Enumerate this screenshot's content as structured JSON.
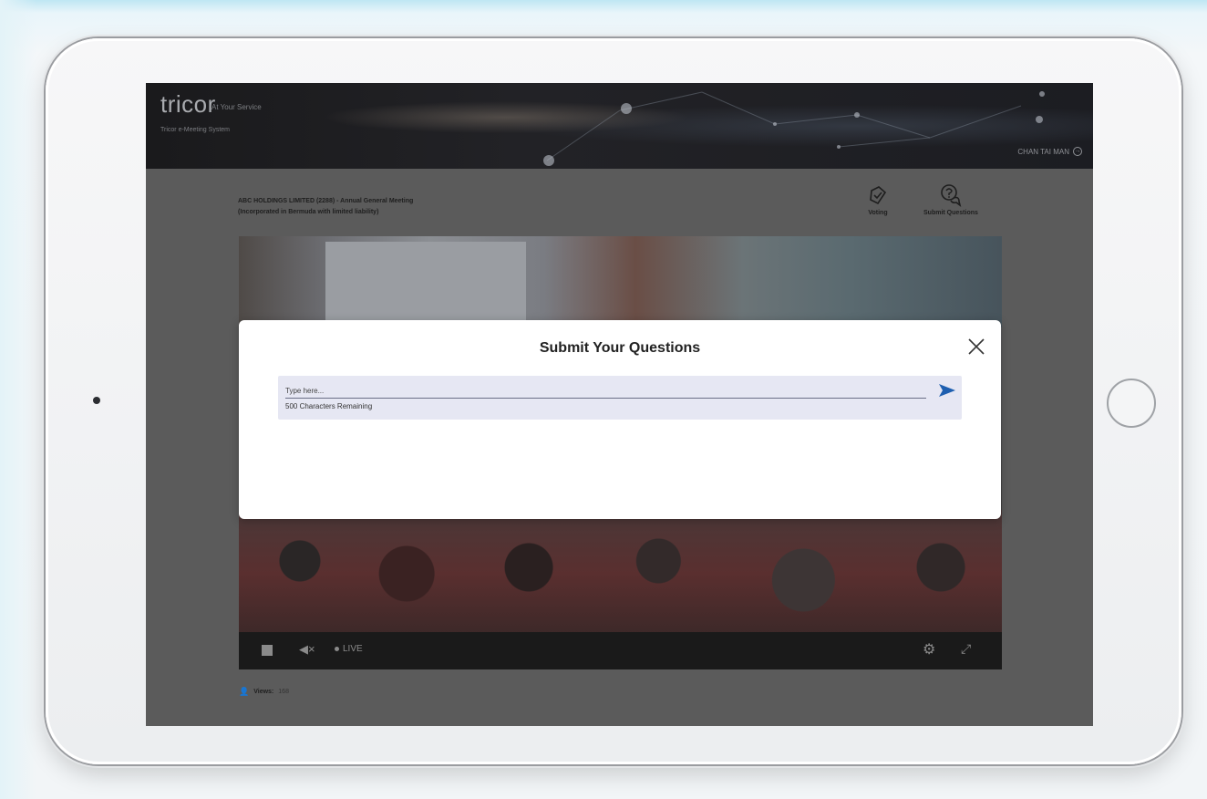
{
  "header": {
    "logo_text": "tricor",
    "tagline": "At Your Service",
    "system_name": "Tricor e-Meeting System",
    "user_name": "CHAN TAI MAN"
  },
  "meeting": {
    "title_line1": "ABC HOLDINGS LIMITED (2288) - Annual General Meeting",
    "title_line2": "(Incorporated in Bermuda with limited liability)"
  },
  "actions": {
    "voting_label": "Voting",
    "submit_questions_label": "Submit Questions"
  },
  "player": {
    "live_label": "LIVE"
  },
  "stats": {
    "views_label": "Views:",
    "views_count": "168"
  },
  "modal": {
    "title": "Submit Your Questions",
    "input_placeholder": "Type here...",
    "char_remaining": "500 Characters Remaining"
  },
  "colors": {
    "send_icon": "#1e5fb0",
    "question_box_bg": "#e6e7f3",
    "overlay": "#5b5b5b"
  },
  "icons": {
    "close": "close-icon",
    "send": "send-icon",
    "voting": "voting-icon",
    "questions": "question-bubble-icon"
  }
}
